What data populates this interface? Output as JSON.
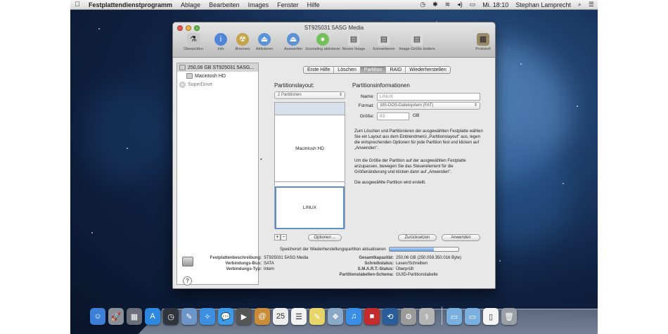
{
  "menubar": {
    "app_name": "Festplattendienstprogramm",
    "menus": [
      "Ablage",
      "Bearbeiten",
      "Images",
      "Fenster",
      "Hilfe"
    ],
    "clock": "Mi. 18:10",
    "user": "Stephan Lamprecht"
  },
  "window": {
    "title": "ST925031 5ASG Media",
    "toolbar": [
      {
        "label": "Überprüfen",
        "icon": "microscope-icon",
        "glyph": "⚗",
        "color": "#c9c9c9"
      },
      {
        "label": "Info",
        "icon": "info-icon",
        "glyph": "i",
        "color": "#4f86d9"
      },
      {
        "label": "Brennen",
        "icon": "burn-icon",
        "glyph": "☢",
        "color": "#c4a34b"
      },
      {
        "label": "Aktivieren",
        "icon": "mount-icon",
        "glyph": "⏏",
        "color": "#5b93d8"
      },
      {
        "label": "Auswerfen",
        "icon": "eject-icon",
        "glyph": "⏏",
        "color": "#5b93d8"
      },
      {
        "label": "Journaling aktivieren",
        "icon": "journaling-icon",
        "glyph": "●",
        "color": "#76c05a"
      },
      {
        "label": "Neues Image",
        "icon": "new-image-icon",
        "glyph": "▤",
        "color": "#d9d9d9"
      },
      {
        "label": "Konvertieren",
        "icon": "convert-icon",
        "glyph": "▤",
        "color": "#d9d9d9"
      },
      {
        "label": "Image-Größe ändern",
        "icon": "resize-image-icon",
        "glyph": "▤",
        "color": "#d9d9d9"
      },
      {
        "label": "Protokoll",
        "icon": "log-icon",
        "glyph": "▦",
        "color": "#9a8a6a"
      }
    ]
  },
  "sidebar": {
    "items": [
      {
        "label": "250,06 GB ST925031 5ASG...",
        "selected": true
      },
      {
        "label": "Macintosh HD"
      },
      {
        "label": "SuperDrive"
      }
    ]
  },
  "tabs": [
    "Erste Hilfe",
    "Löschen",
    "Partition",
    "RAID",
    "Wiederherstellen"
  ],
  "active_tab": "Partition",
  "partition": {
    "layout_heading": "Partitionslayout:",
    "layout_value": "2 Partitionen",
    "map": {
      "mac_label": "Macintosh HD",
      "linux_label": "LINUX"
    },
    "info_heading": "Partitionsinformationen",
    "name_label": "Name:",
    "name_value": "LINUX",
    "format_label": "Format:",
    "format_value": "MS-DOS-Dateisystem (FAT)",
    "size_label": "Größe:",
    "size_value": "83",
    "size_unit": "GB",
    "help_text_1": "Zum Löschen und Partitionieren der ausgewählten Festplatte wählen Sie ein Layout aus dem Einblendmenü „Partitionslayout\" aus, legen die entsprechenden Optionen für jede Partition fest und klicken auf „Anwenden\".",
    "help_text_2": "Um die Größe der Partition auf der ausgewählten Festplatte anzupassen, bewegen Sie das Steuerelement für die Größenänderung und klicken dann auf „Anwenden\".",
    "help_text_3": "Die ausgewählte Partition wird erstellt.",
    "plus": "+",
    "minus": "−",
    "options_btn": "Optionen ...",
    "revert_btn": "Zurücksetzen",
    "apply_btn": "Anwenden"
  },
  "progress": {
    "text": "Speicherort der Wiederherstellungspartition aktualisieren",
    "fraction": 0.65
  },
  "info": {
    "left": [
      {
        "k": "Festplattenbeschreibung:",
        "v": "ST925031 5ASG Media"
      },
      {
        "k": "Verbindungs-Bus:",
        "v": "SATA"
      },
      {
        "k": "Verbindungs-Typ:",
        "v": "Intern"
      }
    ],
    "right": [
      {
        "k": "Gesamtkapazität:",
        "v": "250,06 GB (250.059.350.016 Byte)"
      },
      {
        "k": "Schreibstatus:",
        "v": "Lesen/Schreiben"
      },
      {
        "k": "S.M.A.R.T.-Status:",
        "v": "Überprüft"
      },
      {
        "k": "Partitionstabellen-Schema:",
        "v": "GUID-Partitionstabelle"
      }
    ]
  },
  "help_button": "?",
  "dock": [
    {
      "name": "finder",
      "glyph": "☺",
      "color": "#3b7fd6"
    },
    {
      "name": "launchpad",
      "glyph": "🚀",
      "color": "#8a8f9a"
    },
    {
      "name": "mission-control",
      "glyph": "▦",
      "color": "#6b6f7a"
    },
    {
      "name": "app-store",
      "glyph": "A",
      "color": "#2f88e0"
    },
    {
      "name": "dashboard",
      "glyph": "◷",
      "color": "#30343c"
    },
    {
      "name": "preview",
      "glyph": "✎",
      "color": "#6e95c8"
    },
    {
      "name": "safari",
      "glyph": "✧",
      "color": "#3d8fe0"
    },
    {
      "name": "messages",
      "glyph": "💬",
      "color": "#3b9be8"
    },
    {
      "name": "facetime",
      "glyph": "▶",
      "color": "#555"
    },
    {
      "name": "contacts",
      "glyph": "@",
      "color": "#c98d3a"
    },
    {
      "name": "calendar",
      "glyph": "25",
      "color": "#ededed"
    },
    {
      "name": "reminders",
      "glyph": "☰",
      "color": "#f3f3f3"
    },
    {
      "name": "notes",
      "glyph": "✎",
      "color": "#e8d56a"
    },
    {
      "name": "photos",
      "glyph": "❖",
      "color": "#8aa9c9"
    },
    {
      "name": "itunes",
      "glyph": "♫",
      "color": "#3a8ee6"
    },
    {
      "name": "photo-booth",
      "glyph": "■",
      "color": "#c22c2c"
    },
    {
      "name": "time-machine",
      "glyph": "⟲",
      "color": "#2a5d9a"
    },
    {
      "name": "system-preferences",
      "glyph": "⚙",
      "color": "#9a9a9a"
    },
    {
      "name": "disk-utility",
      "glyph": "⚕",
      "color": "#b5b5b5"
    },
    {
      "name": "applications-folder",
      "glyph": "▭",
      "color": "#7ab0e0"
    },
    {
      "name": "documents-folder",
      "glyph": "▭",
      "color": "#7ab0e0"
    },
    {
      "name": "document",
      "glyph": "▯",
      "color": "#f4f4f4"
    },
    {
      "name": "trash",
      "glyph": "🗑",
      "color": "#9a9ea6"
    }
  ]
}
